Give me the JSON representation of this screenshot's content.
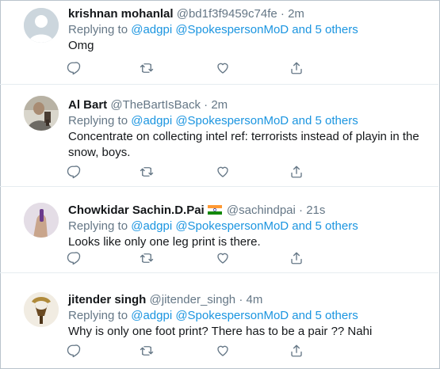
{
  "tweets": [
    {
      "name": "krishnan mohanlal",
      "handle": "@bd1f3f9459c74fe",
      "separator": "·",
      "time": "2m",
      "replying_prefix": "Replying to",
      "mention1": "@adgpi",
      "mention2": "@SpokespersonMoD",
      "and_others": "and 5 others",
      "text": "Omg",
      "avatar": "default-avatar"
    },
    {
      "name": "Al Bart",
      "handle": "@TheBartIsBack",
      "separator": "·",
      "time": "2m",
      "replying_prefix": "Replying to",
      "mention1": "@adgpi",
      "mention2": "@SpokespersonMoD",
      "and_others": "and 5 others",
      "text": "Concentrate on collecting intel ref: terrorists instead of playin in the snow, boys.",
      "avatar": "photo-avatar"
    },
    {
      "name": "Chowkidar Sachin.D.Pai",
      "handle": "@sachindpai",
      "separator": "·",
      "time": "21s",
      "replying_prefix": "Replying to",
      "mention1": "@adgpi",
      "mention2": "@SpokespersonMoD",
      "and_others": "and 5 others",
      "text": "Looks like only one leg print is there.",
      "avatar": "photo-avatar",
      "flag": "india-flag"
    },
    {
      "name": "jitender singh",
      "handle": "@jitender_singh",
      "separator": "·",
      "time": "4m",
      "replying_prefix": "Replying to",
      "mention1": "@adgpi",
      "mention2": "@SpokespersonMoD",
      "and_others": "and 5 others",
      "text": "Why is only one foot print? There has to be a pair ?? Nahi",
      "avatar": "photo-avatar"
    }
  ],
  "actions": [
    "reply-icon",
    "retweet-icon",
    "like-icon",
    "share-icon"
  ],
  "colors": {
    "link": "#1b95e0",
    "muted": "#657786",
    "text": "#14171a",
    "divider": "#e6ecf0"
  }
}
